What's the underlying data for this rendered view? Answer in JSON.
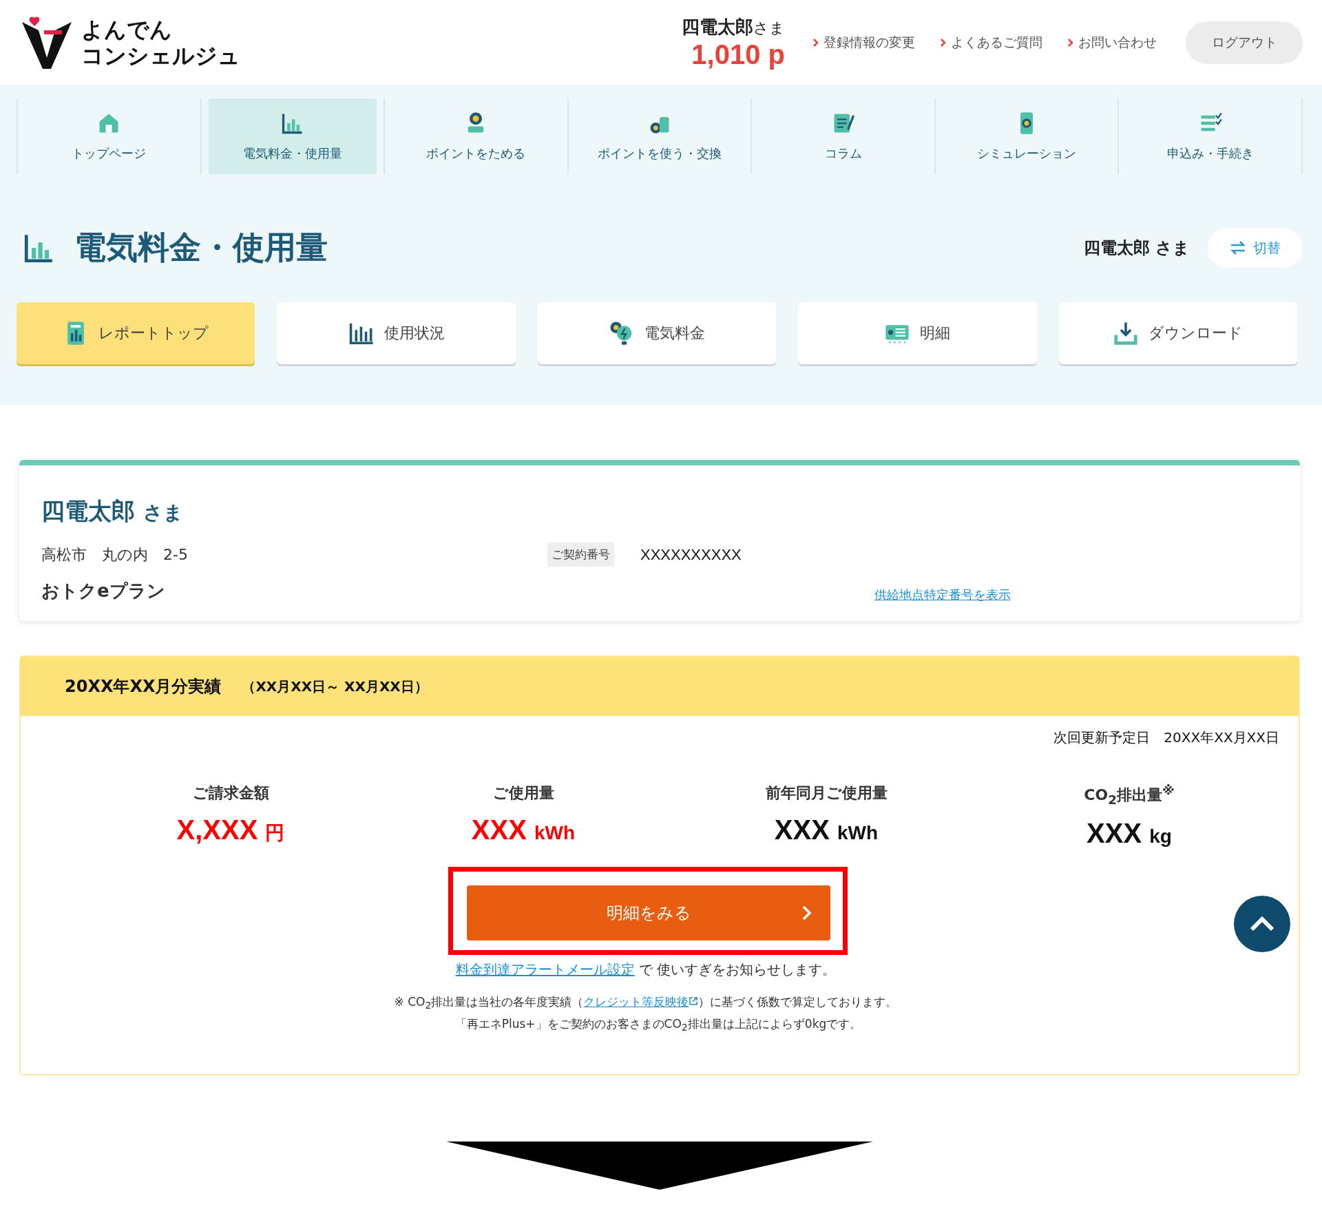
{
  "header": {
    "logo": {
      "line1": "よんでん",
      "line2": "コンシェルジュ"
    },
    "user": {
      "name": "四電太郎",
      "suffix": "さま",
      "points": "1,010 p"
    },
    "links": [
      {
        "label": "登録情報の変更"
      },
      {
        "label": "よくあるご質問"
      },
      {
        "label": "お問い合わせ"
      }
    ],
    "logout": "ログアウト"
  },
  "nav": [
    {
      "label": "トップページ",
      "selected": false
    },
    {
      "label": "電気料金・使用量",
      "selected": true
    },
    {
      "label": "ポイントをためる",
      "selected": false
    },
    {
      "label": "ポイントを使う・交換",
      "selected": false
    },
    {
      "label": "コラム",
      "selected": false
    },
    {
      "label": "シミュレーション",
      "selected": false
    },
    {
      "label": "申込み・手続き",
      "selected": false
    }
  ],
  "page_title": "電気料金・使用量",
  "account": {
    "name": "四電太郎 さま",
    "switch_button": "切替"
  },
  "subnav": [
    {
      "label": "レポートトップ",
      "selected": true
    },
    {
      "label": "使用状況",
      "selected": false
    },
    {
      "label": "電気料金",
      "selected": false
    },
    {
      "label": "明細",
      "selected": false
    },
    {
      "label": "ダウンロード",
      "selected": false
    }
  ],
  "customer": {
    "name": "四電太郎",
    "suffix": "さま",
    "address": "高松市　丸の内　2-5",
    "contract_label": "ご契約番号",
    "contract_number": "XXXXXXXXXX",
    "plan": "おトクeプラン",
    "supply_link": "供給地点特定番号を表示"
  },
  "results": {
    "title": "20XX年XX月分実績",
    "period": "（XX月XX日～ XX月XX日）",
    "next_update": "次回更新予定日　20XX年XX月XX日",
    "metrics": [
      {
        "label": "ご請求金額",
        "value": "X,XXX",
        "unit": "円",
        "emphasis": true
      },
      {
        "label": "ご使用量",
        "value": "XXX",
        "unit": "kWh",
        "emphasis": true
      },
      {
        "label": "前年同月ご使用量",
        "value": "XXX",
        "unit": "kWh",
        "emphasis": false
      },
      {
        "label": "CO$_{2}$排出量$^{※}$",
        "value": "XXX",
        "unit": "kg",
        "emphasis": false
      }
    ],
    "detail_button": "明細をみる",
    "highlighted": true,
    "alert": {
      "link": "料金到達アラートメール設定",
      "text": " で 使いすぎをお知らせします。"
    },
    "note1": {
      "before": "※  CO$_{2}$排出量は当社の各年度実績（",
      "link": "クレジット等反映後",
      "after": "）に基づく係数で算定しております。"
    },
    "note2": "「再エネPlus+」をご契約のお客さまのCO$_{2}$排出量は上記によらず0kgです。"
  }
}
